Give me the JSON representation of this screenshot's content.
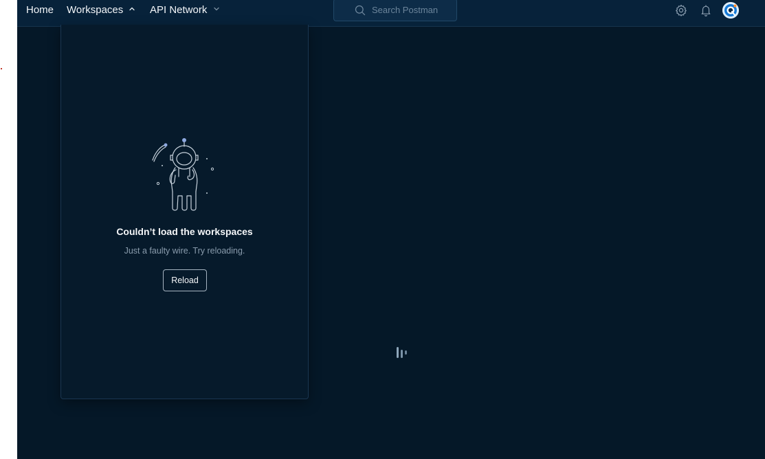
{
  "nav": {
    "home_label": "Home",
    "workspaces_label": "Workspaces",
    "api_network_label": "API Network"
  },
  "search": {
    "placeholder": "Search Postman"
  },
  "icons": {
    "settings": "gear-icon",
    "notifications": "bell-icon",
    "avatar": "avatar"
  },
  "workspaces_dropdown": {
    "error_title": "Couldn’t load the workspaces",
    "error_subtitle": "Just a faulty wire. Try reloading.",
    "reload_label": "Reload"
  },
  "colors": {
    "background": "#051828",
    "topbar": "#07223a",
    "panel": "#061a2b"
  }
}
